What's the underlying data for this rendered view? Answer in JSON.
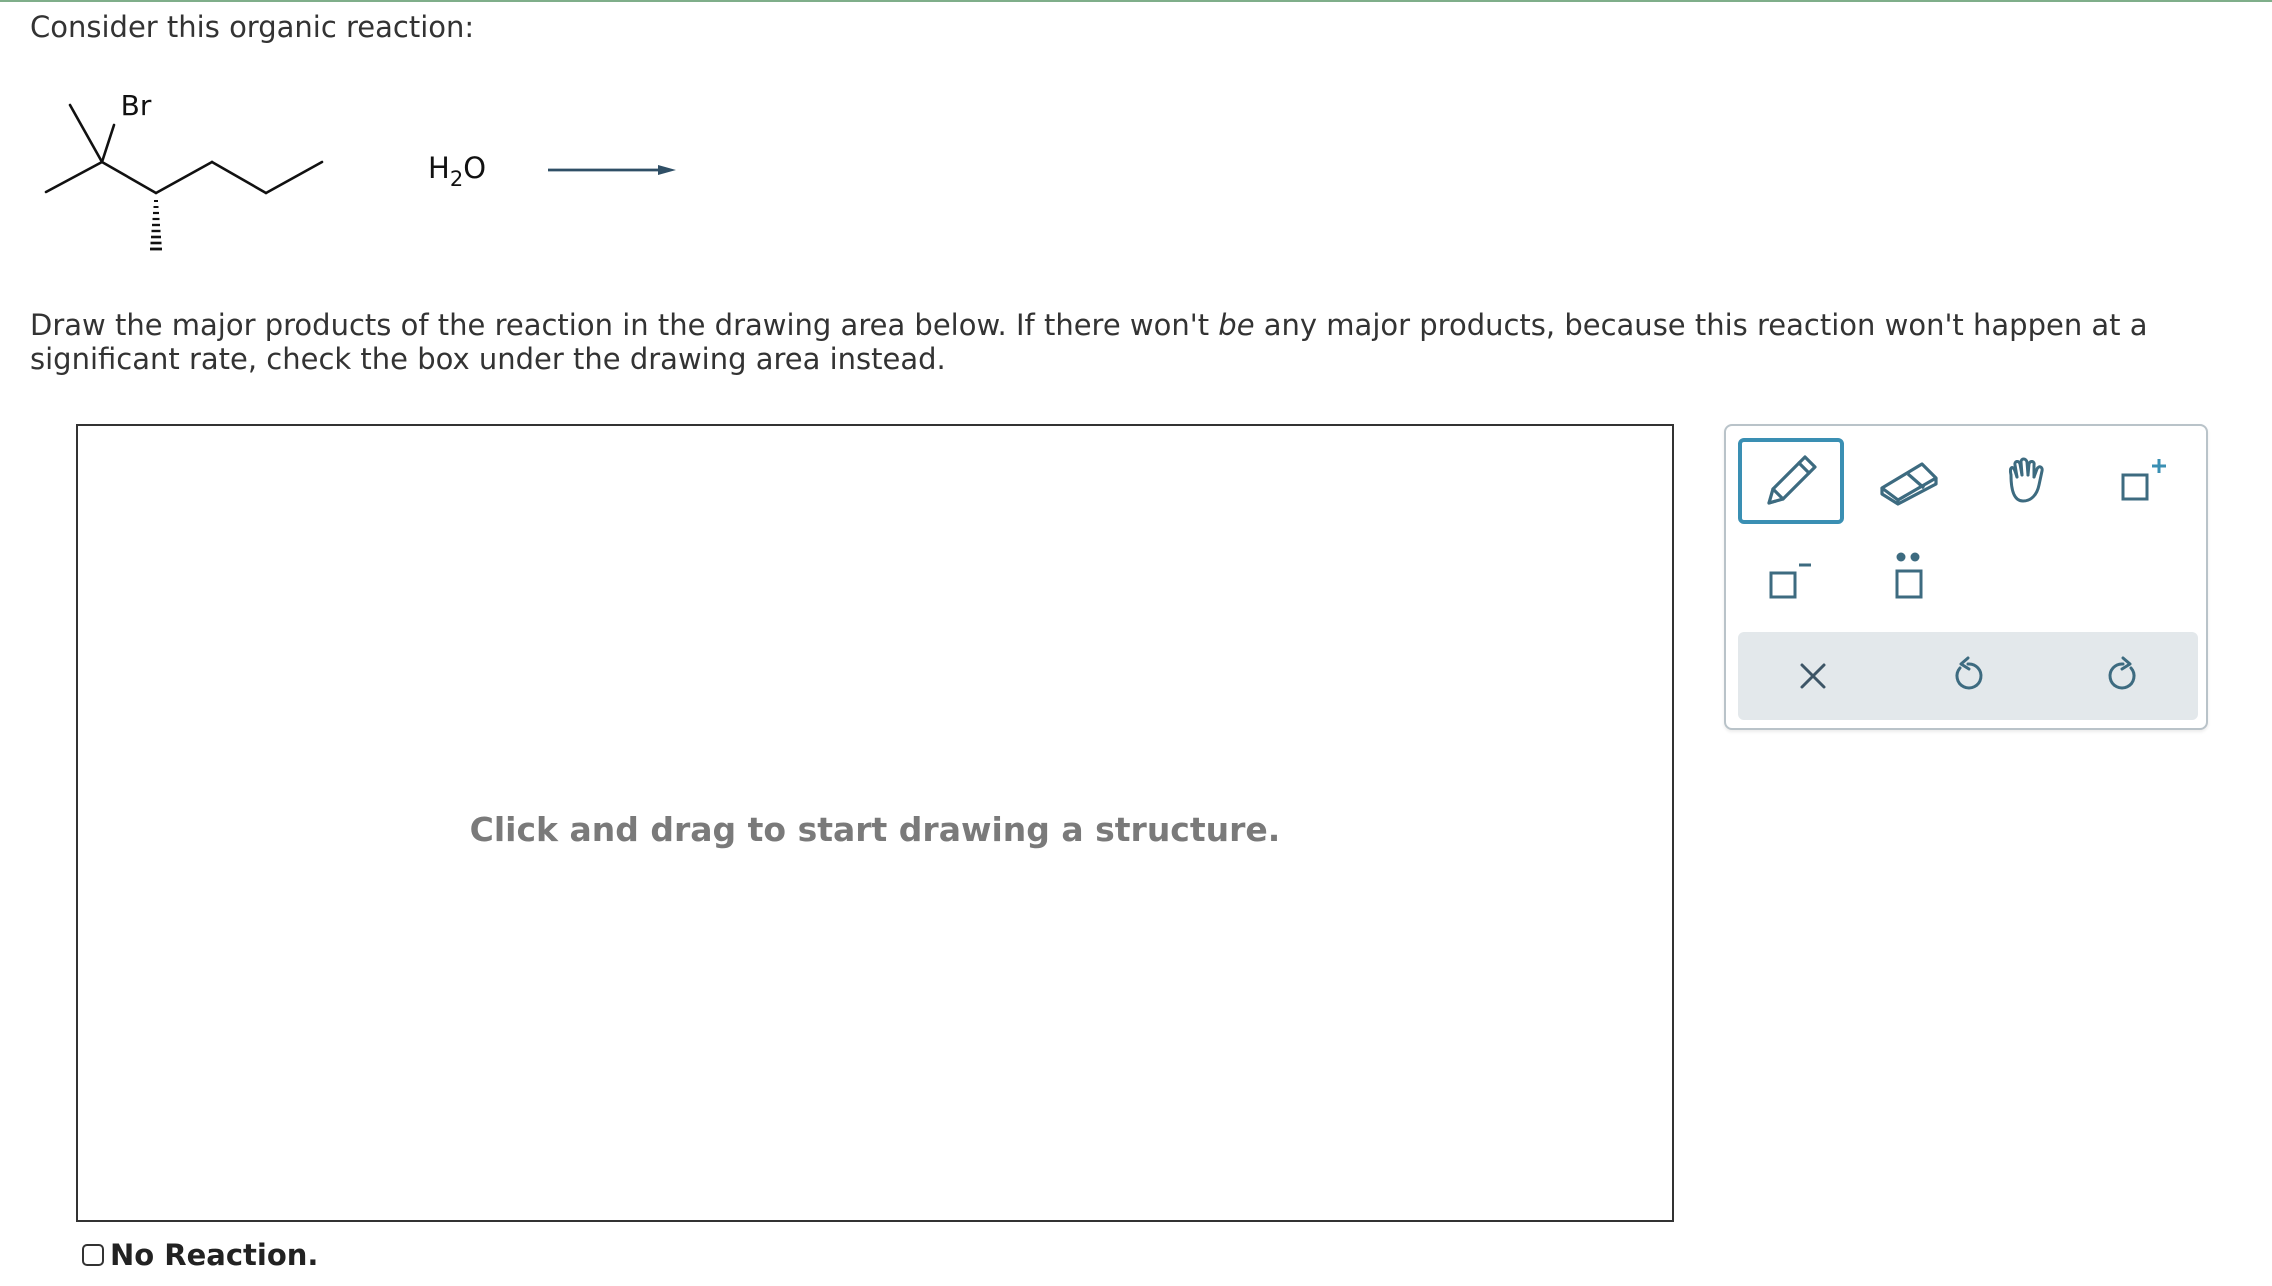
{
  "question": {
    "prompt": "Consider this organic reaction:",
    "reagent_prefix": "H",
    "reagent_subscript": "2",
    "reagent_suffix": "O",
    "substituent_label": "Br",
    "instructions_part1": "Draw the major products of the reaction in the drawing area below. If there won't ",
    "instructions_emphasis": "be",
    "instructions_part2": " any major products, because this reaction won't happen at a significant rate, check the box under the drawing area instead."
  },
  "drawing_area": {
    "hint": "Click and drag to start drawing a structure."
  },
  "toolbar": {
    "tools": [
      "pencil-icon",
      "eraser-icon",
      "hand-icon",
      "add-positive-charge-icon",
      "add-negative-charge-icon",
      "add-lone-pair-icon"
    ],
    "selected_tool": "pencil",
    "actions": [
      "clear-icon",
      "undo-icon",
      "redo-icon"
    ],
    "accent_color": "#3a8fb3",
    "icon_color": "#3d6b80"
  },
  "no_reaction": {
    "label": "No Reaction.",
    "checked": false
  }
}
